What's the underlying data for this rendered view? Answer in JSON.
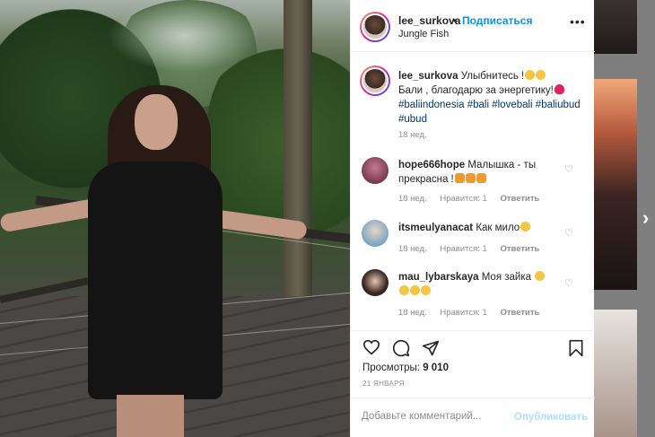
{
  "post": {
    "username": "lee_surkova",
    "separator": "•",
    "follow_label": "Подписаться",
    "location": "Jungle Fish",
    "more": "•••"
  },
  "caption": {
    "username": "lee_surkova",
    "text_line1": "Улыбнитесь !",
    "text_line2": "Бали , благодарю за энергетику!",
    "hashtags": "#baliindonesia #bali #lovebali #baliubud #ubud",
    "time": "18 нед."
  },
  "comments": [
    {
      "username": "hope666hope",
      "text": "Малышка - ты прекрасна !",
      "time": "18 нед.",
      "likes": "Нравится: 1",
      "reply": "Ответить",
      "avatar_color": "#b35a7a"
    },
    {
      "username": "itsmeulyanacat",
      "text": "Как мило",
      "time": "18 нед.",
      "likes": "Нравится: 1",
      "reply": "Ответить",
      "avatar_color": "#8ab0c8"
    },
    {
      "username": "mau_lybarskaya",
      "text": "Моя зайка",
      "time": "18 нед.",
      "likes": "Нравится: 1",
      "reply": "Ответить",
      "avatar_color": "#5a3a2a"
    }
  ],
  "stats": {
    "views_label": "Просмотры:",
    "views_value": "9 010",
    "date": "21 ЯНВАРЯ"
  },
  "add_comment": {
    "placeholder": "Добавьте комментарий...",
    "publish_label": "Опубликовать"
  },
  "icons": {
    "like": "heart-icon",
    "comment": "comment-icon",
    "share": "share-icon",
    "save": "bookmark-icon",
    "next": "chevron-right-icon"
  },
  "colors": {
    "accent": "#0095f6",
    "hashtag": "#00376b",
    "muted": "#8e8e8e",
    "publish_disabled": "#b2dffc"
  }
}
